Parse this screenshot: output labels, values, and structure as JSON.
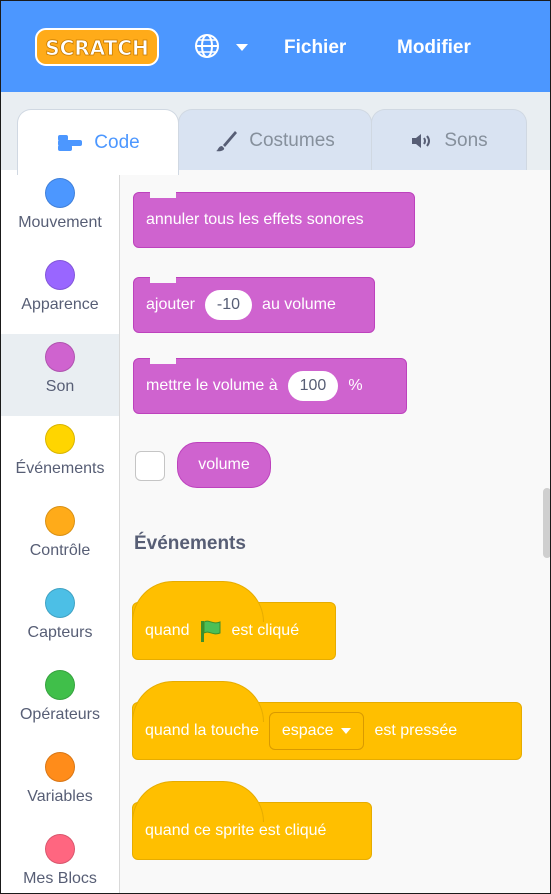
{
  "menubar": {
    "logo_text": "SCRATCH",
    "items": [
      "Fichier",
      "Modifier"
    ],
    "color": "#4c97ff"
  },
  "tabs": [
    {
      "label": "Code",
      "icon": "code-icon",
      "active": true
    },
    {
      "label": "Costumes",
      "icon": "brush-icon",
      "active": false
    },
    {
      "label": "Sons",
      "icon": "speaker-icon",
      "active": false
    }
  ],
  "categories": [
    {
      "label": "Mouvement",
      "color": "#4c97ff"
    },
    {
      "label": "Apparence",
      "color": "#9966ff"
    },
    {
      "label": "Son",
      "color": "#cf63cf",
      "selected": true
    },
    {
      "label": "Événements",
      "color": "#ffd500"
    },
    {
      "label": "Contrôle",
      "color": "#ffab19"
    },
    {
      "label": "Capteurs",
      "color": "#4cbfe6"
    },
    {
      "label": "Opérateurs",
      "color": "#40bf4a"
    },
    {
      "label": "Variables",
      "color": "#ff8c1a"
    },
    {
      "label": "Mes Blocs",
      "color": "#ff6680"
    }
  ],
  "sound_blocks": {
    "clear_effects": "annuler tous les effets sonores",
    "change_volume_prefix": "ajouter",
    "change_volume_value": "-10",
    "change_volume_suffix": "au volume",
    "set_volume_prefix": "mettre le volume à",
    "set_volume_value": "100",
    "set_volume_suffix": "%",
    "volume_reporter": "volume"
  },
  "events": {
    "section_title": "Événements",
    "flag_clicked_prefix": "quand",
    "flag_clicked_suffix": "est cliqué",
    "key_pressed_prefix": "quand la touche",
    "key_pressed_value": "espace",
    "key_pressed_suffix": "est pressée",
    "sprite_clicked": "quand ce sprite est cliqué"
  }
}
